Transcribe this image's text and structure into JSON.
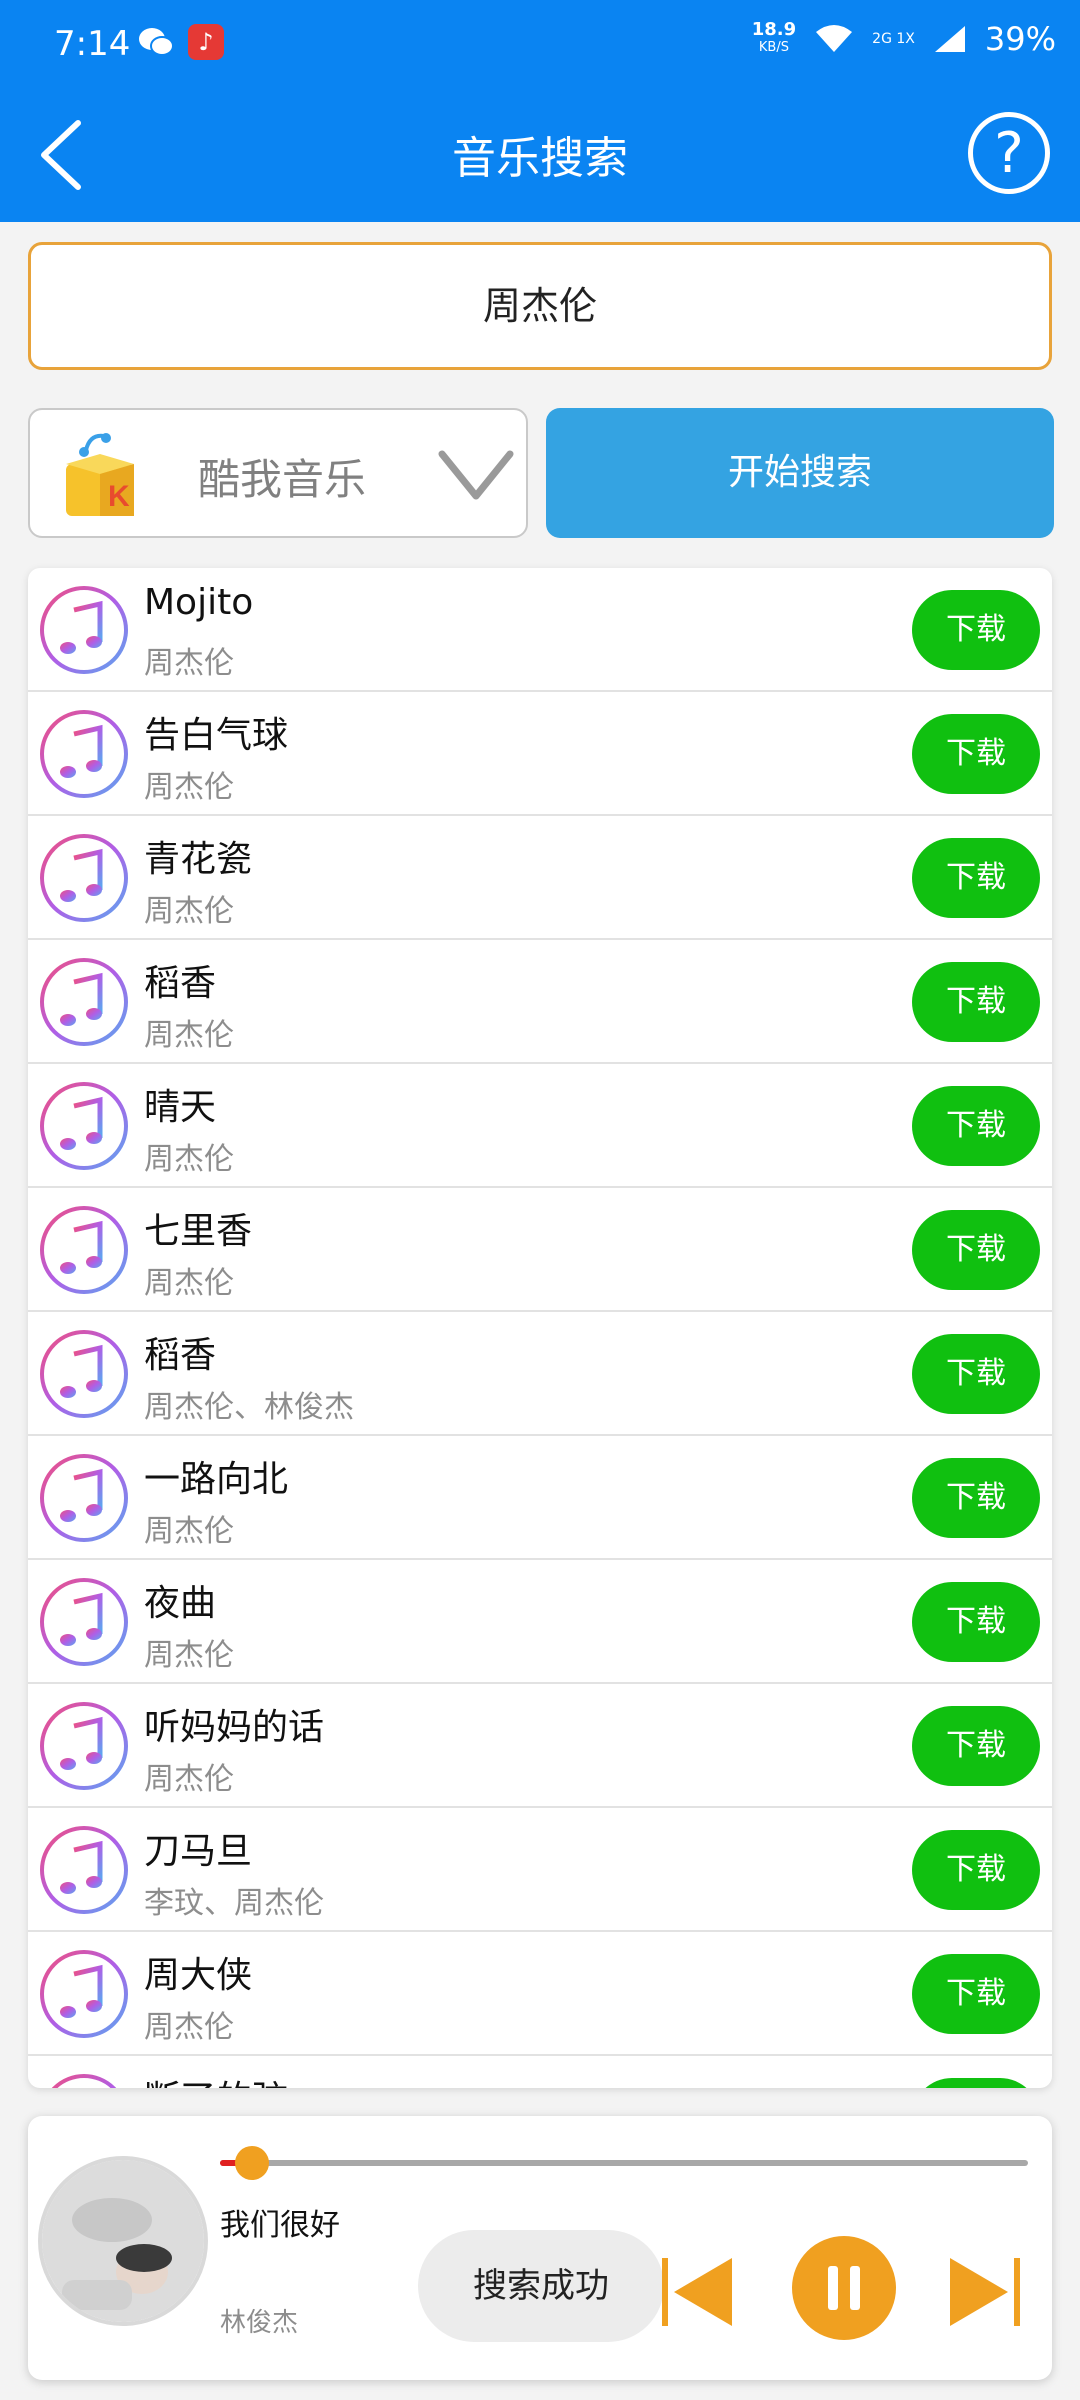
{
  "status_bar": {
    "time": "7:14",
    "net_speed": "18.9",
    "net_unit": "KB/S",
    "signal_label": "2G 1X",
    "battery": "39%"
  },
  "header": {
    "title": "音乐搜索"
  },
  "search": {
    "value": "周杰伦"
  },
  "source": {
    "label": "酷我音乐",
    "logo_letter": "K"
  },
  "actions": {
    "search_label": "开始搜索",
    "download_label": "下载"
  },
  "songs": [
    {
      "title": "Mojito",
      "artist": "周杰伦"
    },
    {
      "title": "告白气球",
      "artist": "周杰伦"
    },
    {
      "title": "青花瓷",
      "artist": "周杰伦"
    },
    {
      "title": "稻香",
      "artist": "周杰伦"
    },
    {
      "title": "晴天",
      "artist": "周杰伦"
    },
    {
      "title": "七里香",
      "artist": "周杰伦"
    },
    {
      "title": "稻香",
      "artist": "周杰伦、林俊杰"
    },
    {
      "title": "一路向北",
      "artist": "周杰伦"
    },
    {
      "title": "夜曲",
      "artist": "周杰伦"
    },
    {
      "title": "听妈妈的话",
      "artist": "周杰伦"
    },
    {
      "title": "刀马旦",
      "artist": "李玟、周杰伦"
    },
    {
      "title": "周大侠",
      "artist": "周杰伦"
    },
    {
      "title": "断了的弦",
      "artist": ""
    }
  ],
  "player": {
    "title": "我们很好",
    "artist": "林俊杰",
    "status": "搜索成功",
    "progress": 0.04
  },
  "colors": {
    "header": "#0a84f2",
    "download": "#10c010",
    "search_button": "#34a3e2",
    "accent": "#f0a020"
  }
}
